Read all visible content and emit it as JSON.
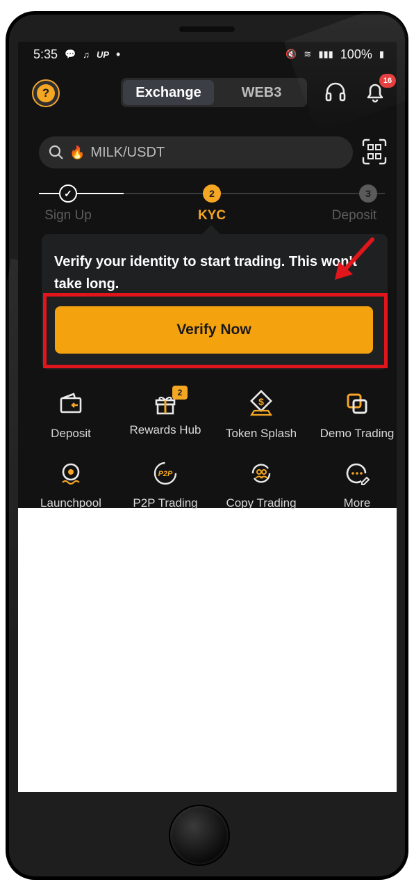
{
  "status_bar": {
    "time": "5:35",
    "left_icons": [
      "talk-bubble-icon",
      "music-icon",
      "UP"
    ],
    "dot": "•",
    "battery": "100%",
    "right_icons": [
      "mute-icon",
      "wifi-icon",
      "signal-icon",
      "battery-icon"
    ]
  },
  "header": {
    "tabs": [
      {
        "label": "Exchange",
        "active": true
      },
      {
        "label": "WEB3",
        "active": false
      }
    ],
    "notification_count": "16"
  },
  "search": {
    "placeholder": "MILK/USDT",
    "prefix_icon": "flame-icon"
  },
  "steps": [
    {
      "label": "Sign Up",
      "state": "done"
    },
    {
      "number": "2",
      "label": "KYC",
      "state": "active"
    },
    {
      "number": "3",
      "label": "Deposit",
      "state": "pending"
    }
  ],
  "kyc_card": {
    "message": "Verify your identity to start trading. This won't take long.",
    "button": "Verify Now"
  },
  "shortcuts": [
    {
      "label": "Deposit",
      "icon": "wallet-icon"
    },
    {
      "label": "Rewards Hub",
      "icon": "gift-icon",
      "badge": "2"
    },
    {
      "label": "Token Splash",
      "icon": "coin-splash-icon"
    },
    {
      "label": "Demo Trading",
      "icon": "demo-squares-icon"
    },
    {
      "label": "Launchpool",
      "icon": "launchpool-icon"
    },
    {
      "label": "P2P Trading",
      "icon": "p2p-icon"
    },
    {
      "label": "Copy Trading",
      "icon": "copy-trading-icon"
    },
    {
      "label": "More",
      "icon": "more-icon"
    }
  ],
  "colors": {
    "accent": "#f5a623",
    "annotation_red": "#e0161c",
    "background": "#121212"
  }
}
